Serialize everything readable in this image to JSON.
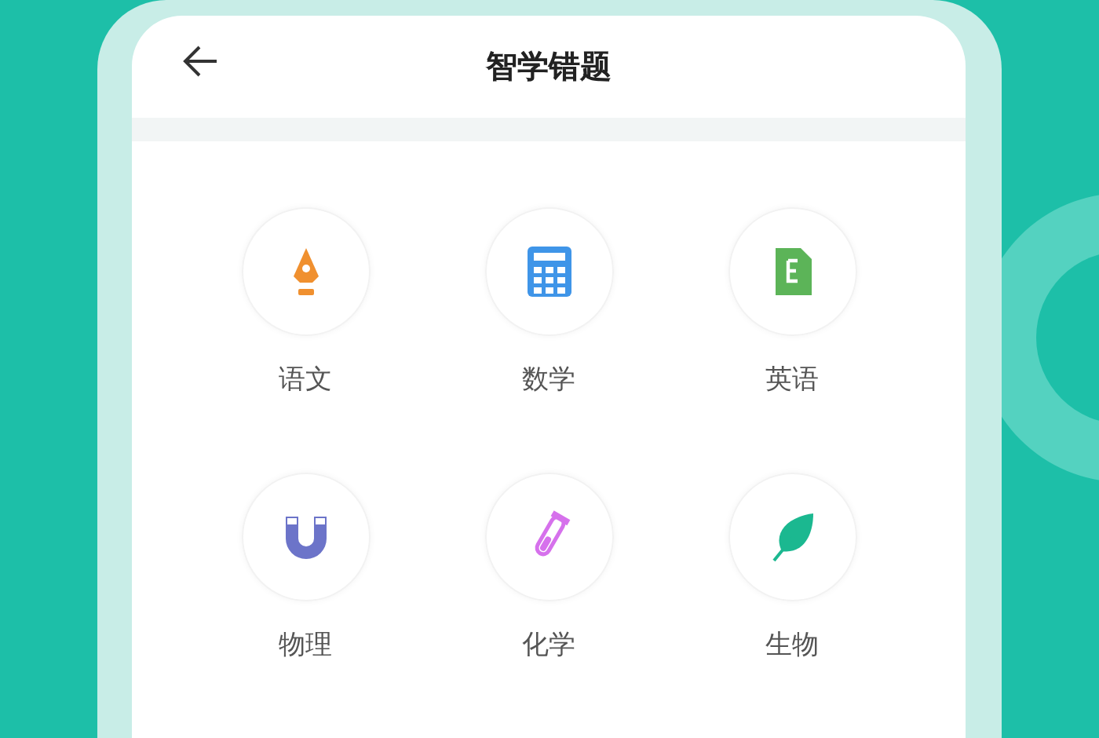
{
  "header": {
    "title": "智学错题"
  },
  "subjects": [
    {
      "label": "语文",
      "kind": "pen"
    },
    {
      "label": "数学",
      "kind": "calculator"
    },
    {
      "label": "英语",
      "kind": "document"
    },
    {
      "label": "物理",
      "kind": "magnet"
    },
    {
      "label": "化学",
      "kind": "tube"
    },
    {
      "label": "生物",
      "kind": "leaf"
    }
  ]
}
